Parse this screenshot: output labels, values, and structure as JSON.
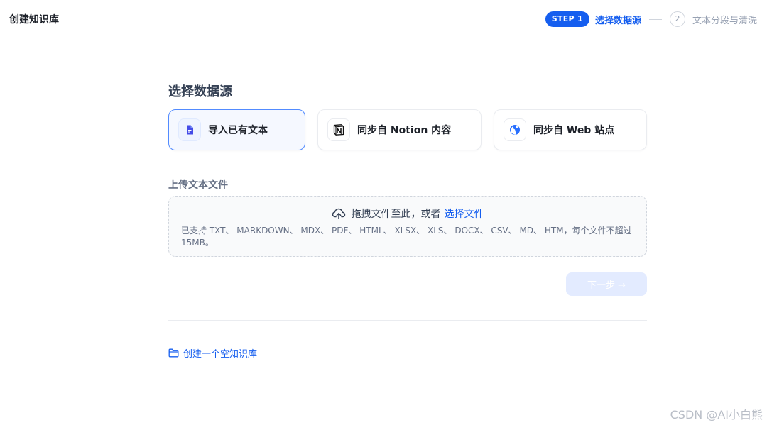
{
  "header": {
    "title": "创建知识库",
    "steps": {
      "active_badge": "STEP 1",
      "active_label": "选择数据源",
      "next_number": "2",
      "next_label": "文本分段与清洗"
    }
  },
  "main": {
    "section_title": "选择数据源",
    "sources": [
      {
        "label": "导入已有文本",
        "icon": "document-icon",
        "active": true
      },
      {
        "label": "同步自 Notion 内容",
        "icon": "notion-logo-icon",
        "active": false
      },
      {
        "label": "同步自 Web 站点",
        "icon": "globe-icon",
        "active": false
      }
    ],
    "upload": {
      "label": "上传文本文件",
      "drop_text": "拖拽文件至此，或者",
      "browse_link": "选择文件",
      "hint": "已支持 TXT、 MARKDOWN、 MDX、 PDF、 HTML、 XLSX、 XLS、 DOCX、 CSV、 MD、 HTM，每个文件不超过 15MB。"
    },
    "next_button": "下一步 →",
    "empty_kb_link": "创建一个空知识库"
  },
  "watermark": "CSDN @AI小白熊",
  "colors": {
    "primary": "#155eef",
    "active_border": "#528bff",
    "disabled_button": "#e3ebff"
  }
}
